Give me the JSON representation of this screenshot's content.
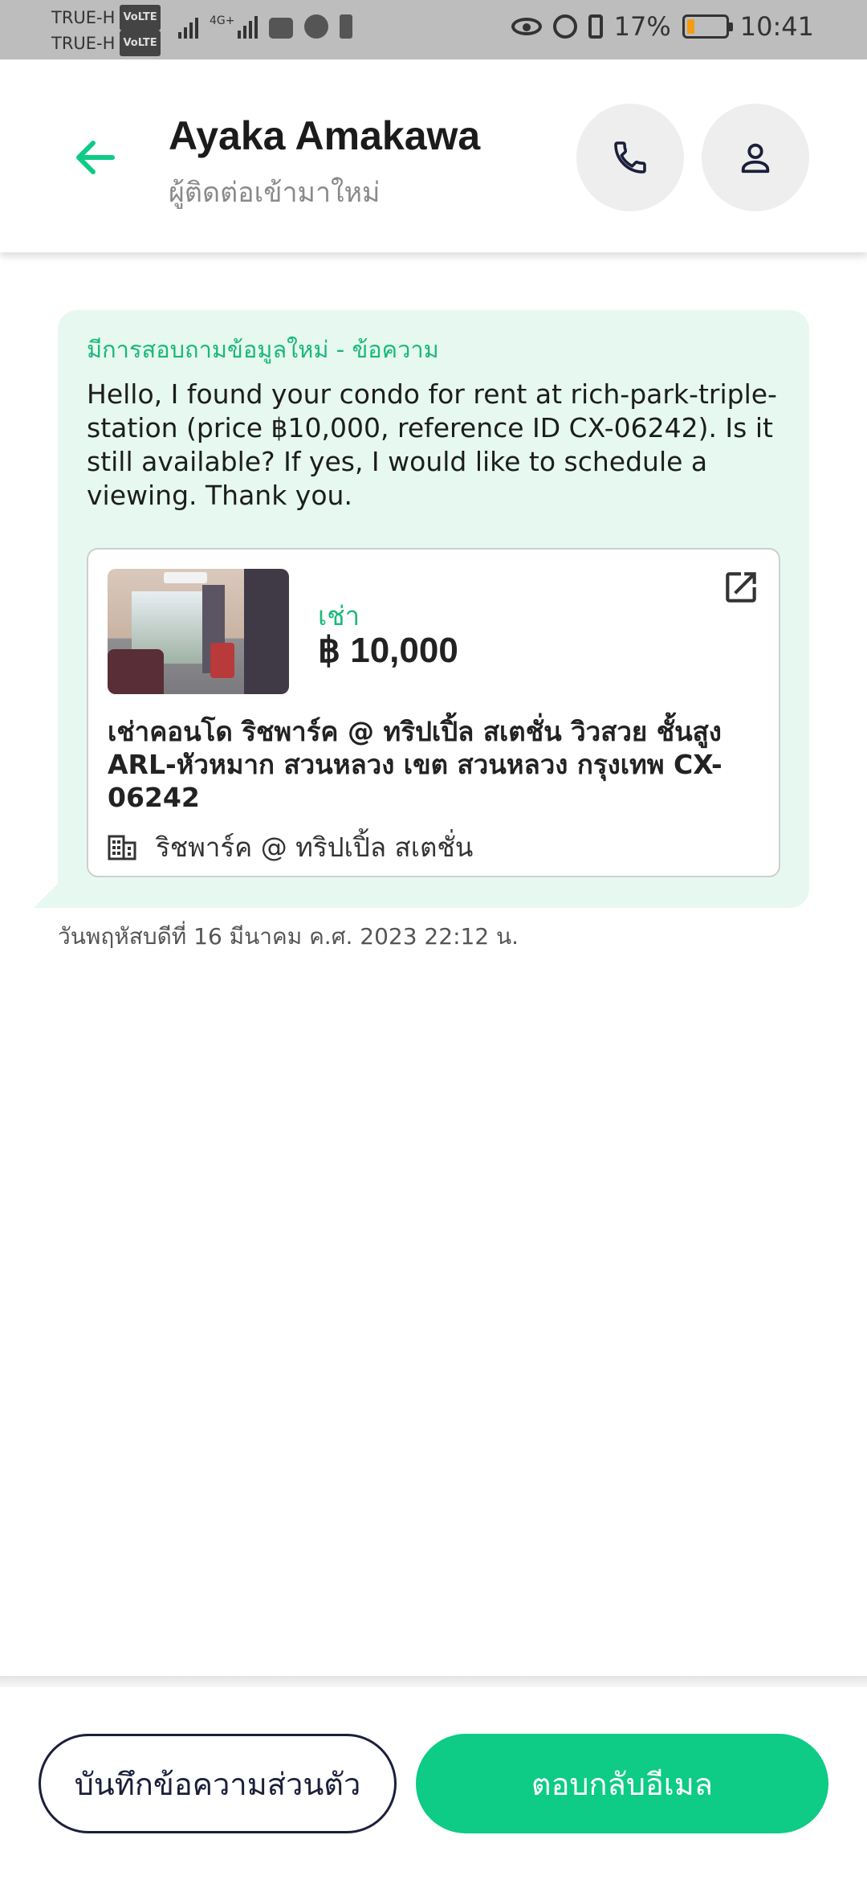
{
  "status_bar": {
    "carrier_1": "TRUE-H",
    "carrier_2": "TRUE-H",
    "volte": "VoLTE",
    "network": "4G+",
    "battery": "17%",
    "time": "10:41"
  },
  "header": {
    "title": "Ayaka Amakawa",
    "subtitle": "ผู้ติดต่อเข้ามาใหม่"
  },
  "message": {
    "heading": "มีการสอบถามข้อมูลใหม่ - ข้อความ",
    "body": "Hello, I found your condo for rent at rich-park-triple-station (price ฿10,000, reference ID CX-06242). Is it still available? If yes, I would like to schedule a viewing. Thank you.",
    "listing": {
      "type": "เช่า",
      "price": "฿ 10,000",
      "title": "เช่าคอนโด  ริชพาร์ค @ ทริปเปิ้ล สเตชั่น วิวสวย ชั้นสูง ARL-หัวหมาก สวนหลวง เขต สวนหลวง กรุงเทพ CX-06242",
      "project": "ริชพาร์ค @ ทริปเปิ้ล สเตชั่น"
    },
    "timestamp": "วันพฤหัสบดีที่ 16 มีนาคม ค.ศ. 2023 22:12 น."
  },
  "actions": {
    "note_label": "บันทึกข้อความส่วนตัว",
    "reply_label": "ตอบกลับอีเมล"
  },
  "colors": {
    "accent": "#0ecb85",
    "bubble": "#e6f8f0",
    "navy": "#1b1f3a"
  }
}
